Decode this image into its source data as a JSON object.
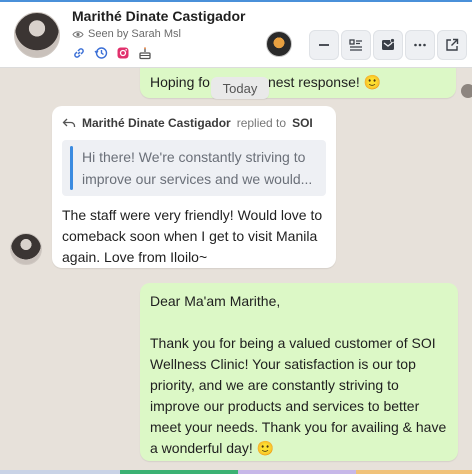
{
  "header": {
    "contact_name": "Marithé Dinate Castigador",
    "seen_by": "Seen by Sarah Msl",
    "icons": [
      "link-icon",
      "history-icon",
      "instagram-icon",
      "cake-icon"
    ],
    "buttons": [
      "minimize-icon",
      "details-icon",
      "inbox-icon",
      "more-icon",
      "open-external-icon"
    ]
  },
  "chat": {
    "top_message_fragment_left": "Hoping fo",
    "top_message_fragment_right": "nest response! 🙂",
    "date_divider": "Today",
    "incoming": {
      "reply_author": "Marithé Dinate Castigador",
      "replied_to_label": "replied to",
      "replied_to_target": "SOI",
      "quote_lines": [
        "Hi there! We're constantly striving to",
        "improve our services and we would..."
      ],
      "text_lines": [
        "The staff were very friendly! Would love to",
        "comeback soon when I get to visit Manila",
        "again. Love from Iloilo~"
      ]
    },
    "outgoing": {
      "greeting": "Dear Ma'am Marithe,",
      "body_lines": [
        "Thank you for being a valued customer of SOI",
        "Wellness Clinic! Your satisfaction is our top",
        "priority, and we are constantly striving to",
        "improve our products and services to better",
        "meet your needs. Thank you for availing & have",
        "a wonderful day! 🙂"
      ]
    }
  },
  "colors": {
    "outgoing_bubble": "#dcf8c6",
    "incoming_bubble": "#ffffff",
    "chat_background": "#e7e1da",
    "accent": "#3b8be0"
  }
}
